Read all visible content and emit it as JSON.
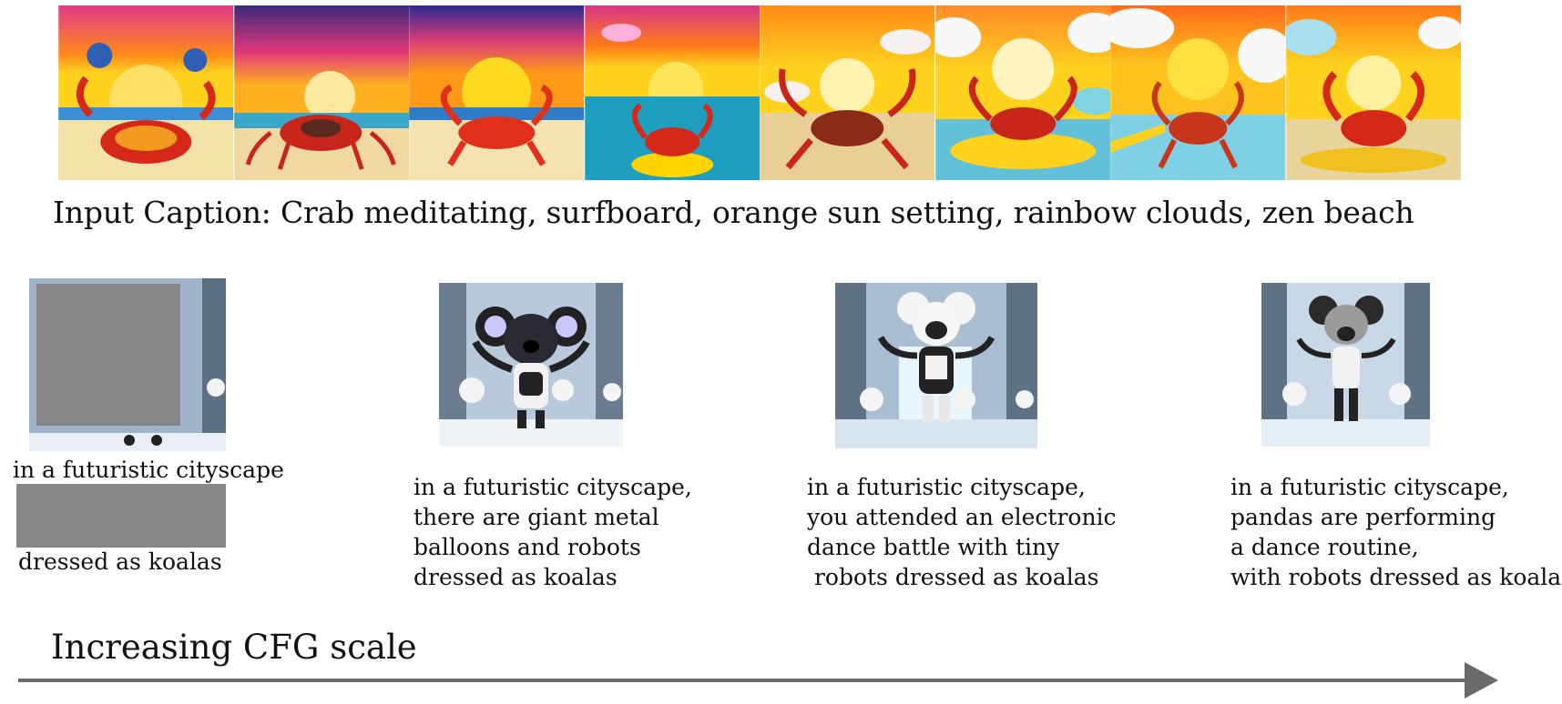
{
  "figure": {
    "caption_text": "Input Caption: Crab meditating, surfboard, orange sun setting, rainbow clouds, zen beach",
    "crab_images": [
      {
        "name": "crab-image-1"
      },
      {
        "name": "crab-image-2"
      },
      {
        "name": "crab-image-3"
      },
      {
        "name": "crab-image-4"
      },
      {
        "name": "crab-image-5"
      },
      {
        "name": "crab-image-6"
      },
      {
        "name": "crab-image-7"
      },
      {
        "name": "crab-image-8"
      }
    ],
    "prompts": [
      {
        "lines": [
          "in a futuristic cityscape",
          "dressed as koalas"
        ]
      },
      {
        "lines": [
          "in a futuristic cityscape,",
          "there are giant metal",
          "balloons and robots",
          "dressed as koalas"
        ]
      },
      {
        "lines": [
          "in a futuristic cityscape,",
          "you attended an electronic",
          "dance battle with tiny",
          " robots dressed as koalas"
        ]
      },
      {
        "lines": [
          "in a futuristic cityscape,",
          "pandas are performing",
          "a dance routine,",
          "with robots dressed as koalas"
        ]
      }
    ],
    "axis_label": "Increasing CFG scale",
    "colors": {
      "arrow": "#6a6a6a",
      "redaction_gray": "#868686",
      "sun": "#ffd21e",
      "sky_orange": "#ff8a1a",
      "crab_red": "#d62818"
    }
  }
}
